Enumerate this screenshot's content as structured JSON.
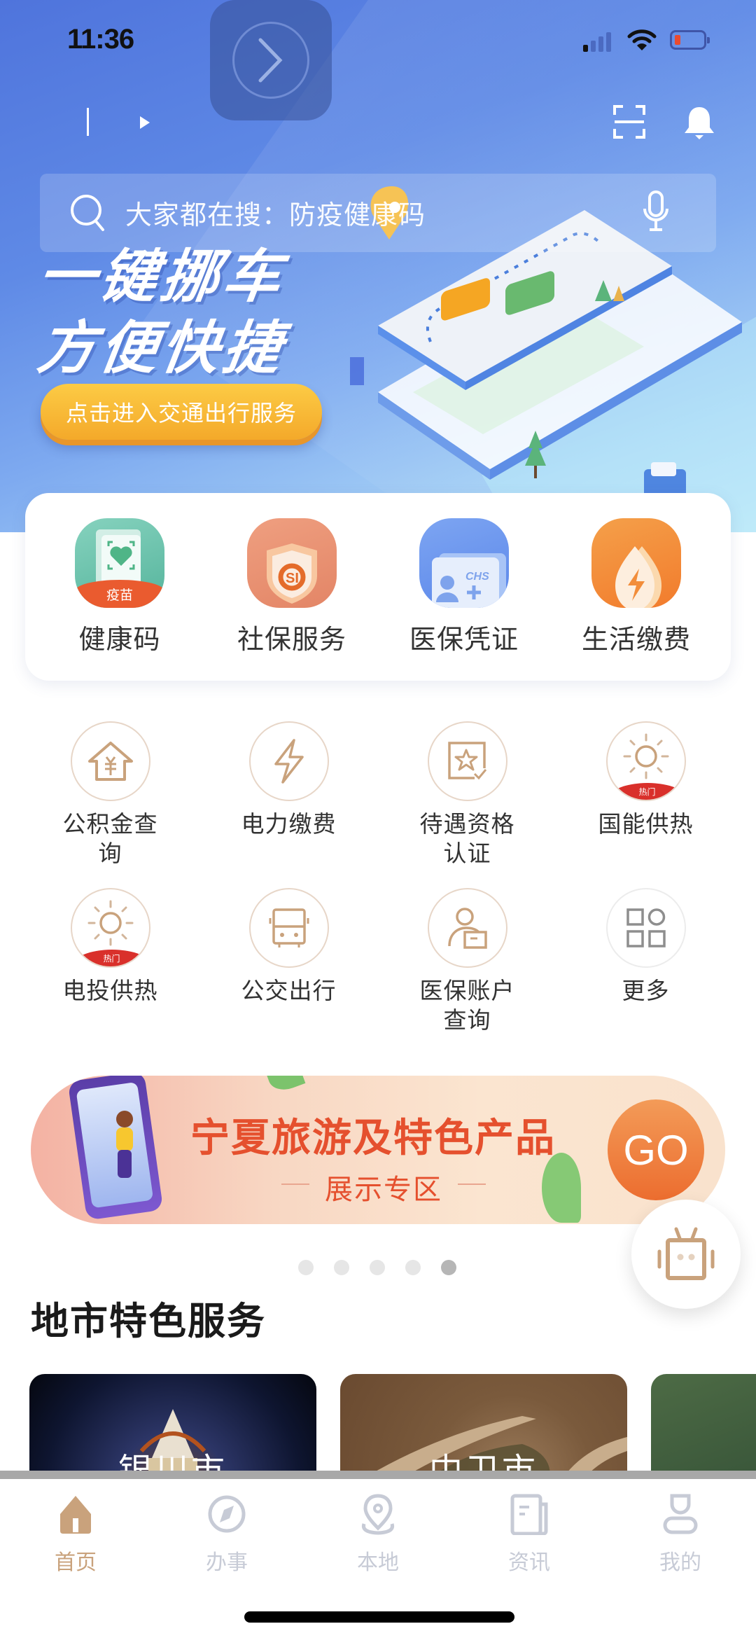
{
  "status_bar": {
    "time": "11:36",
    "battery_level_percent": 10,
    "signal_bars_on": 1,
    "signal_bars_total": 4
  },
  "header": {
    "search": {
      "placeholder": "大家都在搜：防疫健康码",
      "icon": "search-icon",
      "voice_icon": "microphone-icon"
    },
    "scan_icon": "scan-icon",
    "notification_icon": "bell-icon"
  },
  "hero_banner": {
    "title_line1": "一键挪车",
    "title_line2": "方便快捷",
    "cta_label": "点击进入交通出行服务"
  },
  "quick_services": [
    {
      "label": "健康码",
      "icon": "health-code-icon",
      "badge": "疫苗"
    },
    {
      "label": "社保服务",
      "icon": "social-security-icon"
    },
    {
      "label": "医保凭证",
      "icon": "medical-insurance-card-icon",
      "icon_text": "CHS"
    },
    {
      "label": "生活缴费",
      "icon": "utility-payment-icon"
    }
  ],
  "service_grid": [
    {
      "label": "公积金查询",
      "icon": "house-fund-icon"
    },
    {
      "label": "电力缴费",
      "icon": "lightning-icon"
    },
    {
      "label": "待遇资格认证",
      "icon": "star-certificate-icon"
    },
    {
      "label": "国能供热",
      "icon": "sun-icon",
      "badge": "热门"
    },
    {
      "label": "电投供热",
      "icon": "sun-icon",
      "badge": "热门"
    },
    {
      "label": "公交出行",
      "icon": "bus-icon"
    },
    {
      "label": "医保账户查询",
      "icon": "person-card-icon"
    },
    {
      "label": "更多",
      "icon": "more-grid-icon"
    }
  ],
  "promo_banner": {
    "title": "宁夏旅游及特色产品",
    "subtitle": "展示专区",
    "go_label": "GO",
    "carousel_total": 5,
    "carousel_active_index": 4
  },
  "assistant_button": {
    "icon": "robot-icon"
  },
  "city_section": {
    "title": "地市特色服务",
    "cities": [
      {
        "name": "银川市"
      },
      {
        "name": "中卫市"
      },
      {
        "name": ""
      }
    ]
  },
  "tab_bar": {
    "active_index": 0,
    "tabs": [
      {
        "label": "首页",
        "icon": "home-icon"
      },
      {
        "label": "办事",
        "icon": "compass-icon"
      },
      {
        "label": "本地",
        "icon": "location-pin-icon"
      },
      {
        "label": "资讯",
        "icon": "news-icon"
      },
      {
        "label": "我的",
        "icon": "profile-icon"
      }
    ]
  },
  "colors": {
    "brand_gold": "#c9a27c",
    "hero_blue": "#5f8ae6",
    "cta_orange": "#f4a92a",
    "promo_red": "#e5502e",
    "hot_red": "#d9302b",
    "inactive_tab": "#c7cbd6"
  }
}
